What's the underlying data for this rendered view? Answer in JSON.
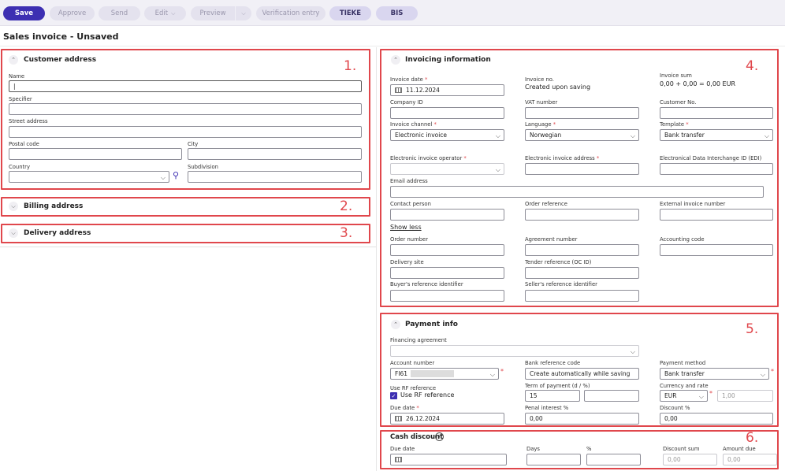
{
  "toolbar": {
    "save": "Save",
    "approve": "Approve",
    "send": "Send",
    "edit": "Edit",
    "preview": "Preview",
    "verification_entry": "Verification entry",
    "tieke": "TIEKE",
    "bis": "BIS"
  },
  "page_title": "Sales invoice - Unsaved",
  "markers": {
    "m1": "1.",
    "m2": "2.",
    "m3": "3.",
    "m4": "4.",
    "m5": "5.",
    "m6": "6."
  },
  "customer_address": {
    "heading": "Customer address",
    "name_label": "Name",
    "name_value": "|",
    "specifier_label": "Specifier",
    "street_label": "Street address",
    "postal_label": "Postal code",
    "city_label": "City",
    "country_label": "Country",
    "subdivision_label": "Subdivision"
  },
  "billing_address": {
    "heading": "Billing address"
  },
  "delivery_address": {
    "heading": "Delivery address"
  },
  "invoicing": {
    "heading": "Invoicing information",
    "invoice_date_label": "Invoice date",
    "invoice_date": "11.12.2024",
    "invoice_no_label": "Invoice no.",
    "invoice_no": "Created upon saving",
    "invoice_sum_label": "Invoice sum",
    "invoice_sum": "0,00 + 0,00 = 0,00 EUR",
    "company_id_label": "Company ID",
    "vat_label": "VAT number",
    "customer_no_label": "Customer No.",
    "channel_label": "Invoice channel",
    "channel": "Electronic invoice",
    "language_label": "Language",
    "language": "Norwegian",
    "template_label": "Template",
    "template": "Bank transfer",
    "operator_label": "Electronic invoice operator",
    "einvoice_address_label": "Electronic invoice address",
    "edi_label": "Electronical Data Interchange ID (EDI)",
    "email_label": "Email address",
    "contact_label": "Contact person",
    "order_ref_label": "Order reference",
    "ext_invoice_label": "External invoice number",
    "show_less": "Show less",
    "order_number_label": "Order number",
    "agreement_label": "Agreement number",
    "accounting_label": "Accounting code",
    "delivery_site_label": "Delivery site",
    "tender_label": "Tender reference (OC ID)",
    "buyer_ref_label": "Buyer's reference identifier",
    "seller_ref_label": "Seller's reference identifier"
  },
  "payment": {
    "heading": "Payment info",
    "financing_label": "Financing agreement",
    "account_label": "Account number",
    "account_prefix": "FI61",
    "bank_ref_label": "Bank reference code",
    "bank_ref": "Create automatically while saving",
    "method_label": "Payment method",
    "method": "Bank transfer",
    "use_rf_label": "Use RF reference",
    "use_rf_check": "Use RF reference",
    "term_label": "Term of payment (d / %)",
    "term_days": "15",
    "currency_label": "Currency and rate",
    "currency": "EUR",
    "rate": "1,00",
    "due_date_label": "Due date",
    "due_date": "26.12.2024",
    "penal_label": "Penal interest %",
    "penal": "0,00",
    "discount_label": "Discount %",
    "discount": "0,00"
  },
  "cash_discount": {
    "heading": "Cash discount",
    "due_date_label": "Due date",
    "days_label": "Days",
    "pct_label": "%",
    "sum_label": "Discount sum",
    "sum": "0,00",
    "amount_due_label": "Amount due",
    "amount_due": "0,00"
  },
  "colors": {
    "accent": "#3d2fb2",
    "annotation": "#e0474c"
  }
}
